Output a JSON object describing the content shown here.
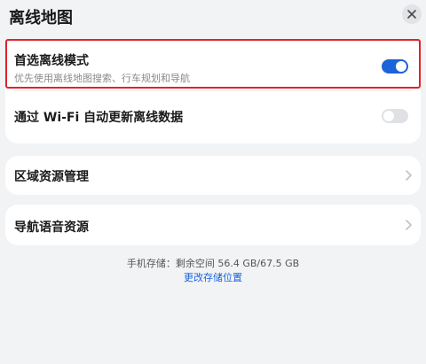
{
  "header": {
    "title": "离线地图",
    "close_icon": "close-icon"
  },
  "offline_mode": {
    "title": "首选离线模式",
    "subtitle": "优先使用离线地图搜索、行车规划和导航",
    "enabled": true,
    "accent_color": "#1a63d8",
    "highlight_color": "#e02328"
  },
  "wifi_update": {
    "title": "通过 Wi-Fi 自动更新离线数据",
    "enabled": false
  },
  "region_management": {
    "title": "区域资源管理",
    "icon": "chevron-right-icon"
  },
  "nav_voice": {
    "title": "导航语音资源",
    "icon": "chevron-right-icon"
  },
  "storage": {
    "info": "手机存储：剩余空间 56.4 GB/67.5 GB",
    "change_link": "更改存储位置"
  }
}
